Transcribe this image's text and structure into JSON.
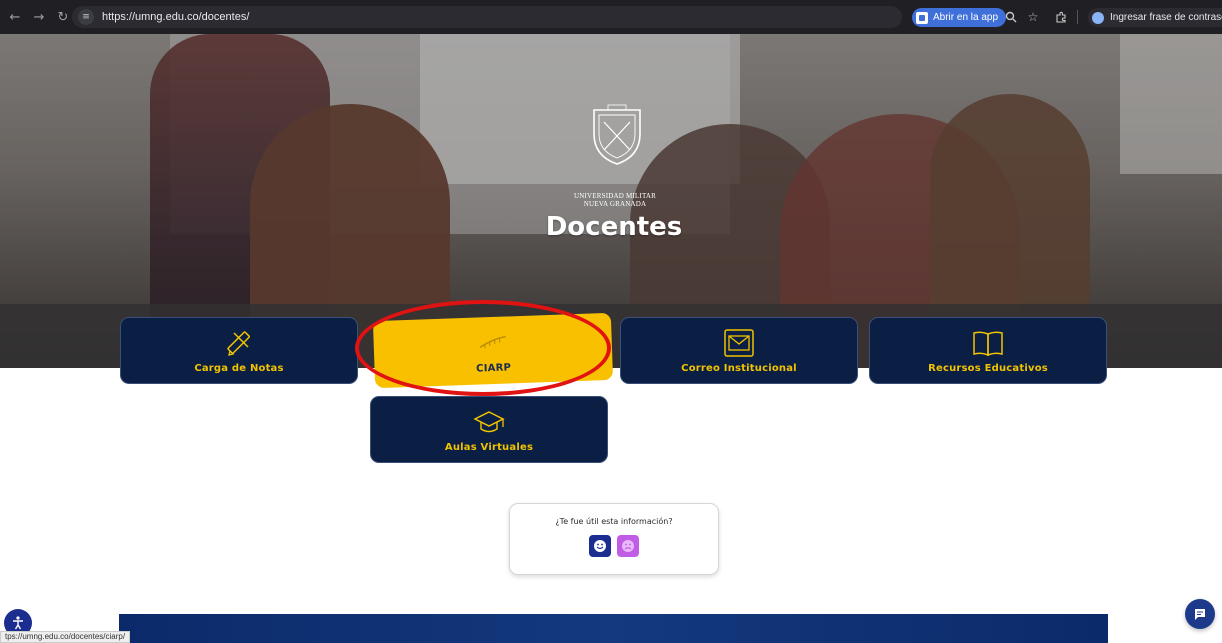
{
  "browser": {
    "url": "https://umng.edu.co/docentes/",
    "open_app_label": "Abrir en la app",
    "password_chip_label": "Ingresar frase de contraseña"
  },
  "hero": {
    "university_line1": "Universidad Militar",
    "university_line2": "Nueva Granada",
    "title": "Docentes"
  },
  "cards": [
    {
      "label": "Carga de Notas",
      "icon": "pencil-ruler-icon",
      "active": false
    },
    {
      "label": "CIARP",
      "icon": "ruler-icon",
      "active": true
    },
    {
      "label": "Correo Institucional",
      "icon": "envelope-icon",
      "active": false
    },
    {
      "label": "Recursos Educativos",
      "icon": "open-book-icon",
      "active": false
    },
    {
      "label": "Aulas Virtuales",
      "icon": "graduation-cap-icon",
      "active": false
    }
  ],
  "feedback": {
    "question": "¿Te fue útil esta información?"
  },
  "status_bar": {
    "hover_url": "tps://umng.edu.co/docentes/ciarp/"
  },
  "colors": {
    "card_bg": "#0b1f44",
    "card_label": "#f2c300",
    "active_card": "#f9c000",
    "highlight": "#e01212"
  }
}
